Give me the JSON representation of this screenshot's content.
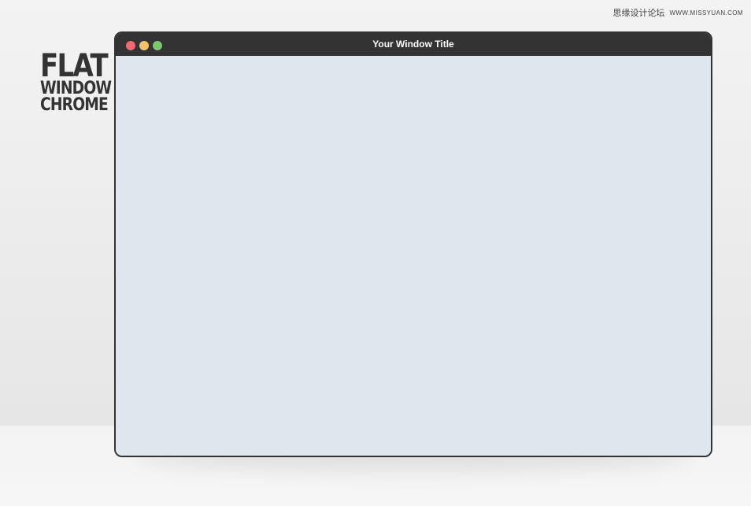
{
  "watermark": {
    "chinese": "思缘设计论坛",
    "site": "WWW.MISSYUAN.COM"
  },
  "brand": {
    "line1": "FLAT",
    "line2": "WINDOW",
    "line3": "CHROME"
  },
  "window": {
    "title": "Your Window Title",
    "controls": [
      {
        "name": "close",
        "color": "#ef6b6f"
      },
      {
        "name": "minimize",
        "color": "#f4c26b"
      },
      {
        "name": "maximize",
        "color": "#7bc86e"
      }
    ],
    "titlebar_color": "#333333",
    "content_color": "#dfe6ed"
  }
}
